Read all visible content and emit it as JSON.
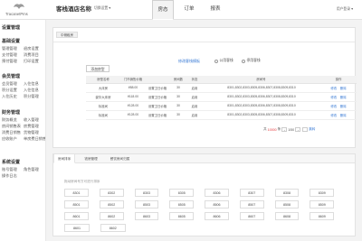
{
  "header": {
    "logo_text": "TracanetPms",
    "hotel_name": "客栈酒店名称",
    "switch_label": "切换设置 ▾",
    "nav": [
      {
        "label": "房态",
        "active": true
      },
      {
        "label": "订单",
        "active": false
      },
      {
        "label": "报表",
        "active": false
      }
    ],
    "user_label": "用户登录 ▾"
  },
  "sidebar": {
    "top": "设置管理",
    "sections": [
      {
        "title": "基础设置",
        "links": [
          "管理管理",
          "退房设置",
          "支付管理",
          "消费项目",
          "预付管理",
          "打印设置"
        ]
      },
      {
        "title": "会员管理",
        "links": [
          "会员管理",
          "入住信息",
          "积分设置",
          "入住信息",
          "入住历史",
          "积分管理"
        ]
      },
      {
        "title": "财务管理",
        "links": [
          "财务概览",
          "收入管理",
          "房间销售表",
          "房费管理",
          "消费日销售",
          "货物管理",
          "应收账户",
          "单房费日销售"
        ]
      },
      {
        "title": "系统设置",
        "links": [
          "账号管理",
          "角色管理",
          "操作日志"
        ]
      }
    ]
  },
  "panel1": {
    "tab": "中储租房",
    "mode_link": "修改客栈模板",
    "mode_options": [
      "公用客栈",
      "停用客栈"
    ],
    "add_button": "添加房型",
    "columns": [
      "房型名称",
      "门市销售价格",
      "",
      "房间数",
      "状态",
      "房间号",
      "操作"
    ],
    "rows": [
      {
        "name": "大床房",
        "price": "¥88.00",
        "setting": "设置卫日价格",
        "count": "30",
        "status": "启用",
        "rooms": "8301,8302,8303,8305,8306,8307,8308,8309,8310",
        "edit": "修改",
        "del": "删除"
      },
      {
        "name": "豪华大床房",
        "price": "¥118.00",
        "setting": "设置卫日价格",
        "count": "30",
        "status": "启用",
        "rooms": "8301,8302,8303,8305,8306,8307,8308,8309,8310",
        "edit": "修改",
        "del": "删除"
      },
      {
        "name": "标准间",
        "price": "¥128.00",
        "setting": "设置卫日价格",
        "count": "30",
        "status": "启用",
        "rooms": "8301,8302,8303,8305,8306,8307,8308,8309,8310",
        "edit": "修改",
        "del": "删除"
      },
      {
        "name": "标准间",
        "price": "¥128.00",
        "setting": "设置卫日价格",
        "count": "30",
        "status": "启用",
        "rooms": "8301,8302,8303,8305,8306,8307,8308,8309,8310",
        "edit": "修改",
        "del": "删除"
      }
    ],
    "pager": {
      "prefix": "共",
      "total": "10000",
      "suffix": "条",
      "page": "1/50",
      "go": "跳转"
    }
  },
  "panel2": {
    "tabs": [
      "房间排序",
      "钱房管理",
      "餐饮房间归属"
    ],
    "hint": "拖动房间号方可进行排序",
    "rooms": [
      [
        "8301",
        "8302",
        "8303",
        "8305",
        "8306",
        "8307",
        "8308",
        "8309"
      ],
      [
        "8501",
        "8502",
        "8503",
        "8505",
        "8506",
        "8507",
        "8508",
        "8509"
      ],
      [
        "8601",
        "8602",
        "8603",
        "8605",
        "8606",
        "8607",
        "8608",
        "8609"
      ],
      [
        "8601",
        "8602"
      ]
    ]
  },
  "colors": {
    "accent_blue": "#3a7bd5",
    "pager_red": "#e4393c",
    "main_bg": "#f3f3f3"
  }
}
